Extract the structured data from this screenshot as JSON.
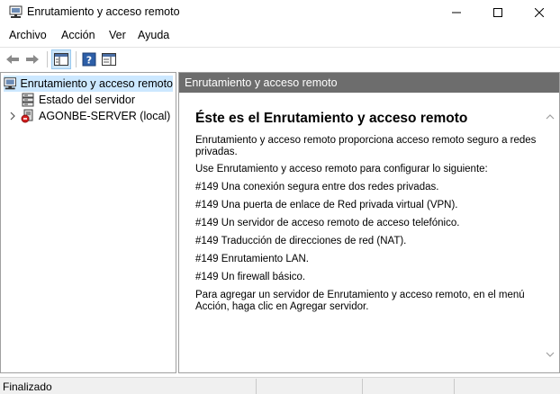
{
  "window": {
    "title": "Enrutamiento y acceso remoto",
    "minimize_icon": "minimize-icon",
    "maximize_icon": "maximize-icon",
    "close_icon": "close-icon"
  },
  "menu": [
    "Archivo",
    "Acción",
    "Ver",
    "Ayuda"
  ],
  "toolbar": {
    "icons": [
      "back-arrow-icon",
      "forward-arrow-icon",
      "show-hide-tree-icon",
      "help-icon",
      "properties-icon"
    ]
  },
  "tree": {
    "root": "Enrutamiento y acceso remoto",
    "items": [
      "Estado del servidor",
      "AGONBE-SERVER (local)"
    ]
  },
  "content": {
    "header": "Enrutamiento y acceso remoto",
    "title": "Éste es el Enrutamiento y acceso remoto",
    "intro": "Enrutamiento y acceso remoto proporciona acceso remoto seguro a redes privadas.",
    "use_text": "Use Enrutamiento y acceso remoto para configurar lo siguiente:",
    "items": [
      "#149 Una conexión segura entre dos redes privadas.",
      "#149 Una puerta de enlace de Red privada virtual (VPN).",
      "#149 Un servidor de acceso remoto de acceso telefónico.",
      "#149 Traducción de direcciones de red (NAT).",
      "#149 Enrutamiento LAN.",
      "#149 Un firewall básico."
    ],
    "footer": "Para agregar un servidor de Enrutamiento y acceso remoto, en el menú Acción, haga clic en Agregar servidor."
  },
  "status": {
    "text": "Finalizado"
  },
  "colors": {
    "header_bg": "#6d6d6d",
    "selection": "#cce8ff",
    "toolbar_active": "#cce4f7"
  }
}
